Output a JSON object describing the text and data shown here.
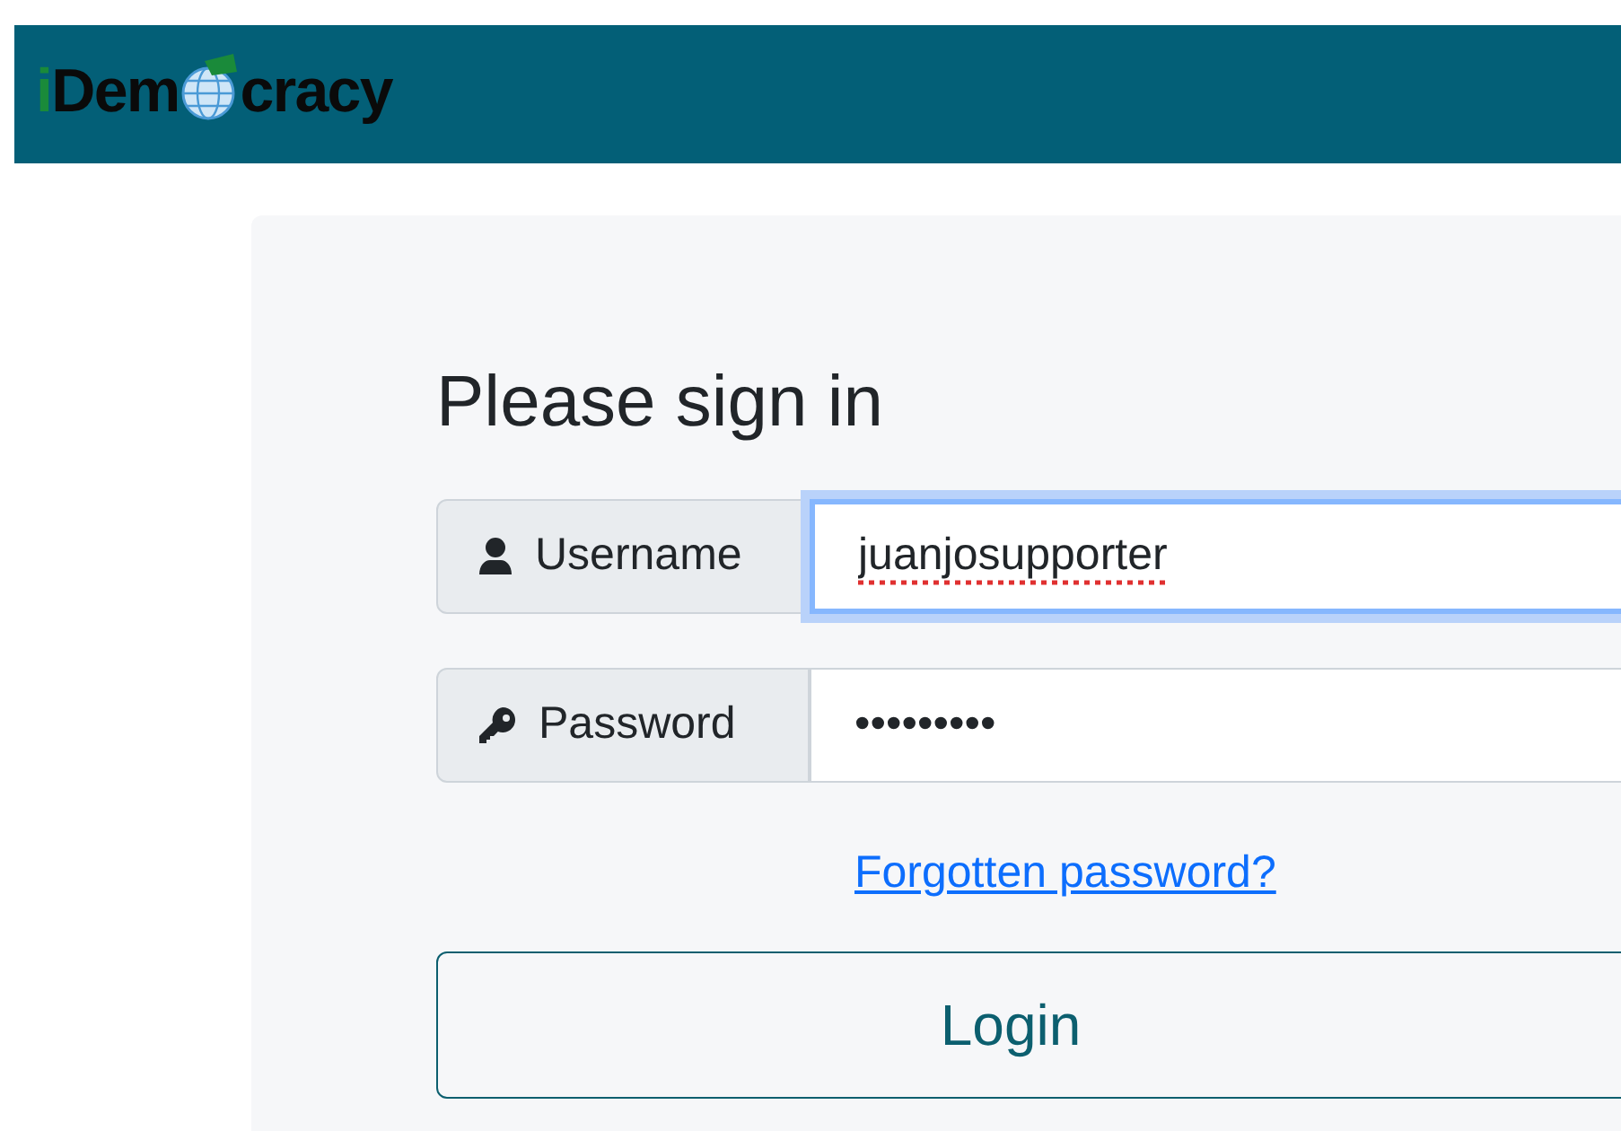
{
  "header": {
    "logo": {
      "initial": "i",
      "before_globe": "Dem",
      "after_globe": "cracy"
    }
  },
  "form": {
    "title": "Please sign in",
    "fields": [
      {
        "kind": "text",
        "label": "Username",
        "value": "juanjosupporter",
        "focused": true,
        "spellcheck_error": true
      },
      {
        "kind": "password",
        "label": "Password",
        "value": "•••••••••",
        "focused": false,
        "spellcheck_error": false
      }
    ],
    "forgot_link": "Forgotten password?",
    "submit": "Login"
  }
}
